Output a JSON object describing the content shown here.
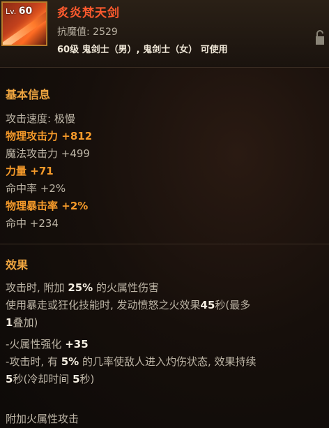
{
  "item": {
    "level_prefix": "Lv.",
    "level": "60",
    "name": "炙炎梵天剑",
    "magic_defense_label": "抗魔值:",
    "magic_defense_value": "2529",
    "usable_text": "60级 鬼剑士（男）, 鬼剑士（女） 可使用",
    "icon": "flame-sword-icon"
  },
  "basic_info": {
    "title": "基本信息",
    "attack_speed": "攻击速度: 极慢",
    "phys_attack_label": "物理攻击力",
    "phys_attack_value": "+812",
    "magic_attack": "魔法攻击力 +499",
    "strength_label": "力量",
    "strength_value": "+71",
    "hit_rate": "命中率 +2%",
    "phys_crit_label": "物理暴击率",
    "phys_crit_value": "+2%",
    "accuracy": "命中 +234"
  },
  "effects": {
    "title": "效果",
    "line1_pre": "攻击时, 附加 ",
    "line1_val": "25%",
    "line1_post": " 的火属性伤害",
    "line2_pre": "使用暴走或狂化技能时, 发动愤怒之火效果",
    "line2_val": "45",
    "line2_mid": "秒(最多",
    "line2_val2": "1",
    "line2_post": "叠加)",
    "line3_pre": "-火属性强化 ",
    "line3_val": "+35",
    "line4_pre": "-攻击时, 有 ",
    "line4_val": "5%",
    "line4_mid": " 的几率使敌人进入灼伤状态, 效果持续",
    "line4_val2": "5",
    "line4_mid2": "秒(冷却时间 ",
    "line4_val3": "5",
    "line4_post": "秒)",
    "footer": "附加火属性攻击"
  },
  "colors": {
    "title": "#ff5a2e",
    "section": "#f0a640",
    "highlight": "#f59a2a",
    "text": "#bdb5a6"
  }
}
